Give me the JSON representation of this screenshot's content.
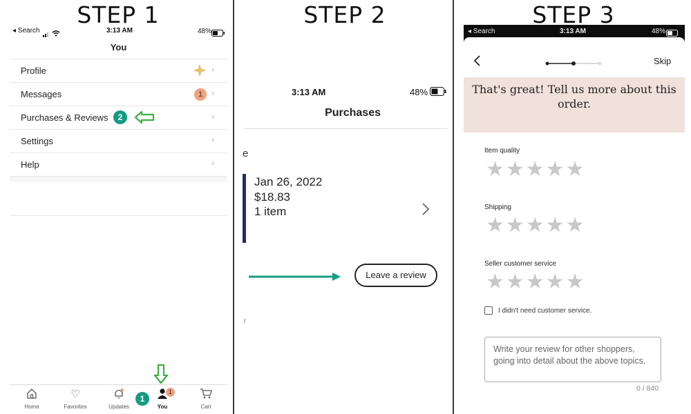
{
  "steps": {
    "step1": "STEP 1",
    "step2": "STEP 2",
    "step3": "STEP 3"
  },
  "panel1": {
    "status_back": "◂ Search",
    "status_time": "3:13 AM",
    "status_battery": "48%",
    "page_title": "You",
    "menu": {
      "profile": "Profile",
      "messages": "Messages",
      "messages_badge": "1",
      "purchases": "Purchases & Reviews",
      "purchases_step": "2",
      "settings": "Settings",
      "help": "Help"
    },
    "tabs": {
      "home": "Home",
      "favorites": "Favorites",
      "updates": "Updates",
      "you": "You",
      "you_badge": "1",
      "you_step": "1",
      "cart": "Cart"
    }
  },
  "panel2": {
    "status_time": "3:13 AM",
    "status_battery": "48%",
    "page_title": "Purchases",
    "cut_letter": "e",
    "order_date": "Jan 26, 2022",
    "order_price": "$18.83",
    "order_items": "1 item",
    "review_button": "Leave a review"
  },
  "panel3": {
    "status_back": "◂ Search",
    "status_time": "3:13 AM",
    "status_battery": "48%",
    "skip": "Skip",
    "heading": "That's great! Tell us more about this order.",
    "item_quality": "Item quality",
    "shipping": "Shipping",
    "seller_service": "Seller customer service",
    "no_service": "I didn't need customer service.",
    "review_placeholder": "Write your review for other shoppers, going into detail about the above topics.",
    "char_count": "0 / 840"
  },
  "colors": {
    "teal": "#149c82",
    "arrow_green": "#3cb043",
    "badge_orange": "#f1a27f",
    "header_pink": "#f1e1db"
  }
}
